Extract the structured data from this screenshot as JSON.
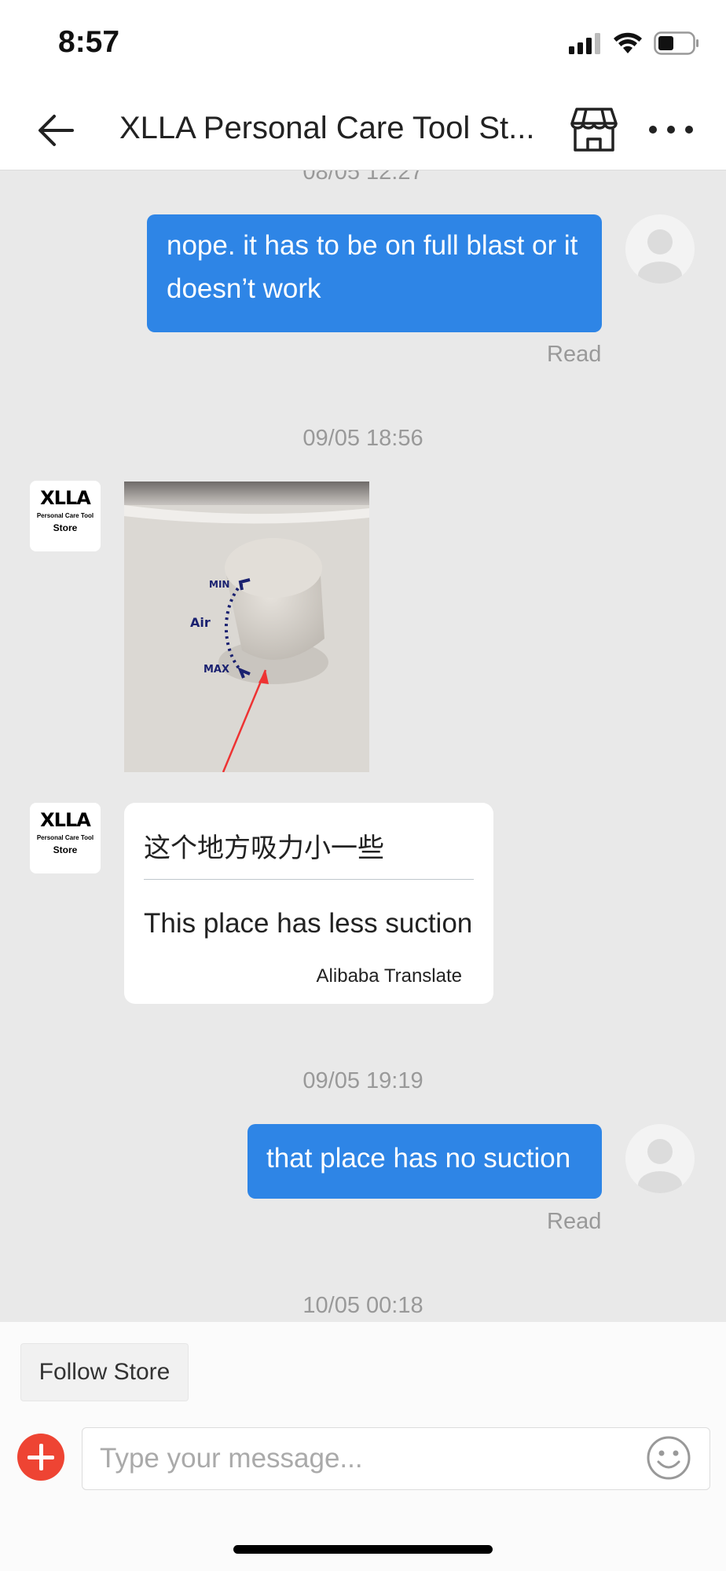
{
  "status_bar": {
    "time": "8:57"
  },
  "header": {
    "title": "XLLA Personal Care Tool St..."
  },
  "store_logo": {
    "big": "XLLA",
    "mid": "Personal Care Tool",
    "small": "Store"
  },
  "messages": {
    "ts_top": "08/05 12:27",
    "out1": "nope. it has to be on full blast or it doesn’t work",
    "out1_status": "Read",
    "ts2": "09/05 18:56",
    "image_labels": {
      "min": "MIN",
      "air": "Air",
      "max": "MAX"
    },
    "translation": {
      "original": "这个地方吸力小一些",
      "translated": "This place has less suction",
      "source": "Alibaba Translate"
    },
    "ts3": "09/05 19:19",
    "out2": "that place has no suction",
    "out2_status": "Read",
    "ts4": "10/05 00:18"
  },
  "footer": {
    "follow_label": "Follow Store",
    "input_placeholder": "Type your message..."
  },
  "colors": {
    "accent": "#2e85e6",
    "plus": "#ee4433",
    "chat_bg": "#e9e9e9"
  }
}
